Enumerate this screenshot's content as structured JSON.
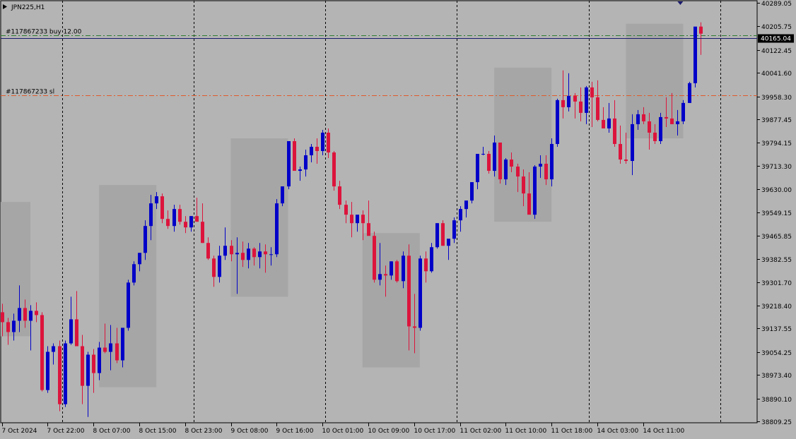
{
  "chart_data": {
    "type": "candlestick",
    "symbol_label": "JPN225,H1",
    "colors": {
      "background": "#b4b4b4",
      "bull": "#0000c8",
      "bear": "#dc143c",
      "grid": "#000000",
      "box": "#a6a6a6",
      "buy_line": "#2e7d32",
      "sl_line": "#e05a2a",
      "current_price_line": "#1a1a6e",
      "current_price_box": "#000000"
    },
    "ylim": [
      38809.25,
      40289.05
    ],
    "y_ticks": [
      "40289.05",
      "40205.75",
      "40122.45",
      "40041.60",
      "39958.30",
      "39877.45",
      "39794.15",
      "39713.30",
      "39630.00",
      "39549.15",
      "39465.85",
      "39382.55",
      "39301.70",
      "39218.40",
      "39137.55",
      "39054.25",
      "38973.40",
      "38890.10",
      "38809.25"
    ],
    "x_labels": [
      "7 Oct 2024",
      "7 Oct 22:00",
      "8 Oct 07:00",
      "8 Oct 15:00",
      "8 Oct 23:00",
      "9 Oct 08:00",
      "9 Oct 16:00",
      "10 Oct 01:00",
      "10 Oct 09:00",
      "10 Oct 17:00",
      "11 Oct 02:00",
      "11 Oct 10:00",
      "11 Oct 18:00",
      "14 Oct 03:00",
      "14 Oct 11:00"
    ],
    "x_label_bar_index": [
      0,
      8,
      16,
      24,
      32,
      40,
      48,
      56,
      64,
      72,
      80,
      88,
      96,
      104,
      112
    ],
    "session_separator_bar_index": [
      10.5,
      33.5,
      56.5,
      79.5,
      102.5,
      125.5
    ],
    "candles": [
      [
        39195,
        39225,
        39110,
        39160
      ],
      [
        39160,
        39175,
        39080,
        39125
      ],
      [
        39125,
        39190,
        39095,
        39165
      ],
      [
        39165,
        39290,
        39125,
        39210
      ],
      [
        39210,
        39240,
        39140,
        39165
      ],
      [
        39165,
        39220,
        39060,
        39200
      ],
      [
        39200,
        39230,
        39160,
        39185
      ],
      [
        39185,
        39195,
        38915,
        38920
      ],
      [
        38920,
        39075,
        38910,
        39055
      ],
      [
        39055,
        39085,
        39010,
        39075
      ],
      [
        39075,
        39095,
        38845,
        38870
      ],
      [
        38870,
        39095,
        38860,
        39085
      ],
      [
        39085,
        39250,
        39080,
        39170
      ],
      [
        39170,
        39270,
        39080,
        39075
      ],
      [
        39075,
        39115,
        38870,
        38935
      ],
      [
        38935,
        39055,
        38825,
        39045
      ],
      [
        39045,
        39065,
        38910,
        38980
      ],
      [
        38980,
        39090,
        38955,
        39070
      ],
      [
        39070,
        39155,
        39050,
        39055
      ],
      [
        39055,
        39150,
        38990,
        39085
      ],
      [
        39085,
        39140,
        39015,
        39025
      ],
      [
        39025,
        39135,
        39000,
        39140
      ],
      [
        39140,
        39310,
        39130,
        39300
      ],
      [
        39300,
        39375,
        39290,
        39365
      ],
      [
        39365,
        39405,
        39340,
        39405
      ],
      [
        39405,
        39520,
        39380,
        39500
      ],
      [
        39500,
        39610,
        39450,
        39580
      ],
      [
        39580,
        39620,
        39560,
        39605
      ],
      [
        39605,
        39615,
        39510,
        39525
      ],
      [
        39525,
        39555,
        39490,
        39500
      ],
      [
        39500,
        39575,
        39480,
        39560
      ],
      [
        39560,
        39575,
        39505,
        39515
      ],
      [
        39515,
        39535,
        39475,
        39495
      ],
      [
        39495,
        39535,
        39480,
        39535
      ],
      [
        39535,
        39600,
        39530,
        39515
      ],
      [
        39515,
        39580,
        39440,
        39440
      ],
      [
        39440,
        39460,
        39380,
        39385
      ],
      [
        39385,
        39395,
        39285,
        39320
      ],
      [
        39320,
        39430,
        39300,
        39395
      ],
      [
        39395,
        39495,
        39380,
        39430
      ],
      [
        39430,
        39450,
        39375,
        39400
      ],
      [
        39400,
        39460,
        39260,
        39405
      ],
      [
        39405,
        39445,
        39355,
        39380
      ],
      [
        39380,
        39440,
        39350,
        39420
      ],
      [
        39420,
        39425,
        39360,
        39390
      ],
      [
        39390,
        39440,
        39350,
        39410
      ],
      [
        39410,
        39435,
        39335,
        39400
      ],
      [
        39400,
        39425,
        39360,
        39400
      ],
      [
        39400,
        39595,
        39390,
        39580
      ],
      [
        39580,
        39640,
        39570,
        39640
      ],
      [
        39640,
        39800,
        39630,
        39800
      ],
      [
        39800,
        39810,
        39695,
        39695
      ],
      [
        39695,
        39710,
        39660,
        39700
      ],
      [
        39700,
        39770,
        39675,
        39750
      ],
      [
        39750,
        39790,
        39725,
        39780
      ],
      [
        39780,
        39810,
        39720,
        39765
      ],
      [
        39765,
        39840,
        39750,
        39830
      ],
      [
        39830,
        39845,
        39740,
        39760
      ],
      [
        39760,
        39765,
        39625,
        39640
      ],
      [
        39640,
        39660,
        39560,
        39575
      ],
      [
        39575,
        39590,
        39510,
        39540
      ],
      [
        39540,
        39585,
        39460,
        39510
      ],
      [
        39510,
        39530,
        39480,
        39540
      ],
      [
        39540,
        39555,
        39450,
        39510
      ],
      [
        39510,
        39590,
        39470,
        39465
      ],
      [
        39465,
        39480,
        39300,
        39310
      ],
      [
        39310,
        39440,
        39290,
        39330
      ],
      [
        39330,
        39360,
        39250,
        39325
      ],
      [
        39325,
        39375,
        39310,
        39375
      ],
      [
        39375,
        39380,
        39300,
        39305
      ],
      [
        39305,
        39410,
        39280,
        39395
      ],
      [
        39395,
        39435,
        39060,
        39145
      ],
      [
        39145,
        39260,
        39050,
        39140
      ],
      [
        39140,
        39395,
        39130,
        39385
      ],
      [
        39385,
        39410,
        39300,
        39340
      ],
      [
        39340,
        39440,
        39335,
        39425
      ],
      [
        39425,
        39510,
        39420,
        39510
      ],
      [
        39510,
        39520,
        39430,
        39430
      ],
      [
        39430,
        39450,
        39380,
        39455
      ],
      [
        39455,
        39530,
        39440,
        39520
      ],
      [
        39520,
        39570,
        39480,
        39560
      ],
      [
        39560,
        39580,
        39530,
        39590
      ],
      [
        39590,
        39620,
        39580,
        39655
      ],
      [
        39655,
        39720,
        39630,
        39755
      ],
      [
        39755,
        39780,
        39750,
        39755
      ],
      [
        39755,
        39765,
        39685,
        39695
      ],
      [
        39695,
        39820,
        39675,
        39795
      ],
      [
        39795,
        39790,
        39650,
        39665
      ],
      [
        39665,
        39740,
        39645,
        39735
      ],
      [
        39735,
        39760,
        39690,
        39710
      ],
      [
        39710,
        39720,
        39620,
        39675
      ],
      [
        39675,
        39700,
        39570,
        39615
      ],
      [
        39615,
        39690,
        39560,
        39540
      ],
      [
        39540,
        39715,
        39525,
        39710
      ],
      [
        39710,
        39750,
        39670,
        39720
      ],
      [
        39720,
        39750,
        39645,
        39665
      ],
      [
        39665,
        39810,
        39640,
        39790
      ],
      [
        39790,
        39950,
        39780,
        39945
      ],
      [
        39945,
        40050,
        39880,
        39920
      ],
      [
        39920,
        40040,
        39905,
        39960
      ],
      [
        39960,
        39970,
        39880,
        39940
      ],
      [
        39940,
        39990,
        39870,
        39900
      ],
      [
        39900,
        39995,
        39860,
        39990
      ],
      [
        39990,
        40010,
        39850,
        39955
      ],
      [
        39955,
        40015,
        39870,
        39875
      ],
      [
        39875,
        39920,
        39850,
        39845
      ],
      [
        39845,
        39935,
        39830,
        39880
      ],
      [
        39880,
        39945,
        39780,
        39790
      ],
      [
        39790,
        39855,
        39720,
        39735
      ],
      [
        39735,
        39830,
        39720,
        39730
      ],
      [
        39730,
        39895,
        39680,
        39860
      ],
      [
        39860,
        39910,
        39840,
        39895
      ],
      [
        39895,
        39920,
        39860,
        39870
      ],
      [
        39870,
        39900,
        39770,
        39830
      ],
      [
        39830,
        39860,
        39790,
        39800
      ],
      [
        39800,
        39900,
        39790,
        39885
      ],
      [
        39885,
        39955,
        39850,
        39880
      ],
      [
        39880,
        39970,
        39860,
        39860
      ],
      [
        39860,
        39910,
        39820,
        39870
      ],
      [
        39870,
        39945,
        39860,
        39935
      ],
      [
        39935,
        40010,
        39935,
        40005
      ],
      [
        40005,
        40200,
        39990,
        40205
      ],
      [
        40205,
        40220,
        40105,
        40180
      ]
    ],
    "boxes": [
      {
        "x0": -1,
        "x1": 5,
        "y_top": 39585,
        "y_bottom": 39110
      },
      {
        "x0": 17,
        "x1": 27,
        "y_top": 39645,
        "y_bottom": 38930
      },
      {
        "x0": 40,
        "x1": 50,
        "y_top": 39810,
        "y_bottom": 39250
      },
      {
        "x0": 63,
        "x1": 73,
        "y_top": 39475,
        "y_bottom": 39000
      },
      {
        "x0": 86,
        "x1": 96,
        "y_top": 40060,
        "y_bottom": 39515
      },
      {
        "x0": 109,
        "x1": 119,
        "y_top": 40215,
        "y_bottom": 39810
      }
    ],
    "order_lines": [
      {
        "name": "buy-order-line",
        "label": "#117867233 buy 12.00",
        "price": 40175.0,
        "color": "#2e7d32"
      },
      {
        "name": "stop-loss-line",
        "label": "#117867233 sl",
        "price": 39962.0,
        "color": "#e05a2a"
      }
    ],
    "current_price": {
      "value": 40165.04,
      "label": "40165.04"
    },
    "marker_bar_index": 118.5
  }
}
